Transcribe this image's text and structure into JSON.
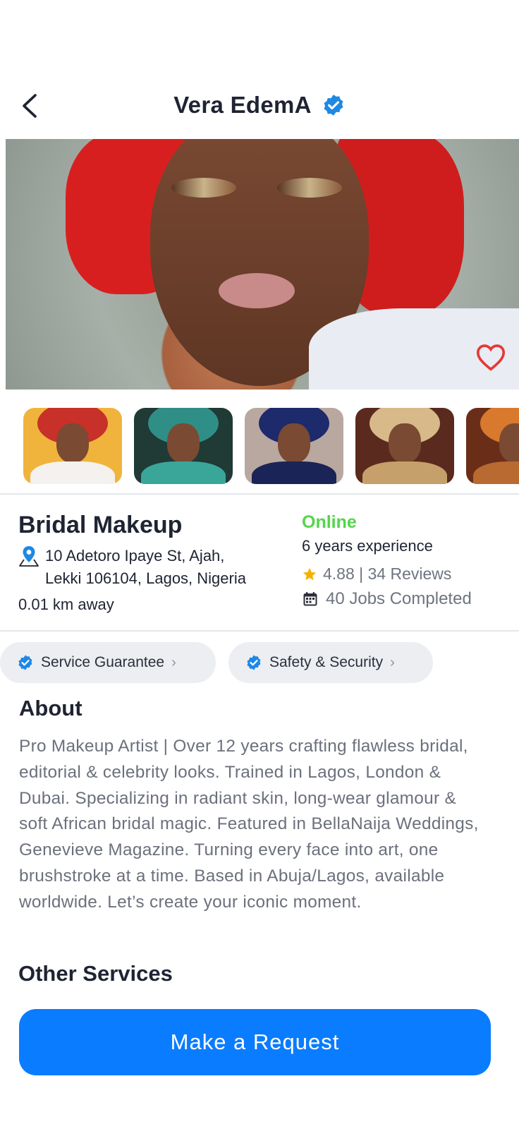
{
  "header": {
    "title": "Vera EdemA",
    "back_icon": "chevron-left-icon",
    "verified_icon": "verified-badge-icon"
  },
  "gallery": {
    "favorite_icon": "heart-outline-icon",
    "thumbnail_count_visible": 5
  },
  "service": {
    "name": "Bridal Makeup",
    "address_line1": "10 Adetoro Ipaye St, Ajah,",
    "address_line2": "Lekki 106104, Lagos, Nigeria",
    "distance": "0.01 km away",
    "status": "Online",
    "experience": "6 years experience",
    "rating": "4.88 | 34 Reviews",
    "jobs": "40 Jobs Completed"
  },
  "badges": [
    {
      "label": "Service Guarantee"
    },
    {
      "label": "Safety & Security"
    }
  ],
  "about": {
    "title": "About",
    "text": "Pro Makeup Artist | Over 12 years crafting flawless bridal, editorial & celebrity looks. Trained in Lagos, London & Dubai. Specializing in radiant skin, long-wear glamour & soft African bridal magic. Featured in BellaNaija Weddings, Genevieve Magazine. Turning every face into art, one brushstroke at a time. Based in Abuja/Lagos, available worldwide. Let’s create your iconic moment."
  },
  "other_services": {
    "title": "Other Services"
  },
  "cta": {
    "label": "Make a Request"
  },
  "colors": {
    "primary": "#0A7CFF",
    "online": "#52D64A",
    "star": "#F5B100",
    "favorite": "#E53935",
    "verified": "#1E88E5"
  }
}
